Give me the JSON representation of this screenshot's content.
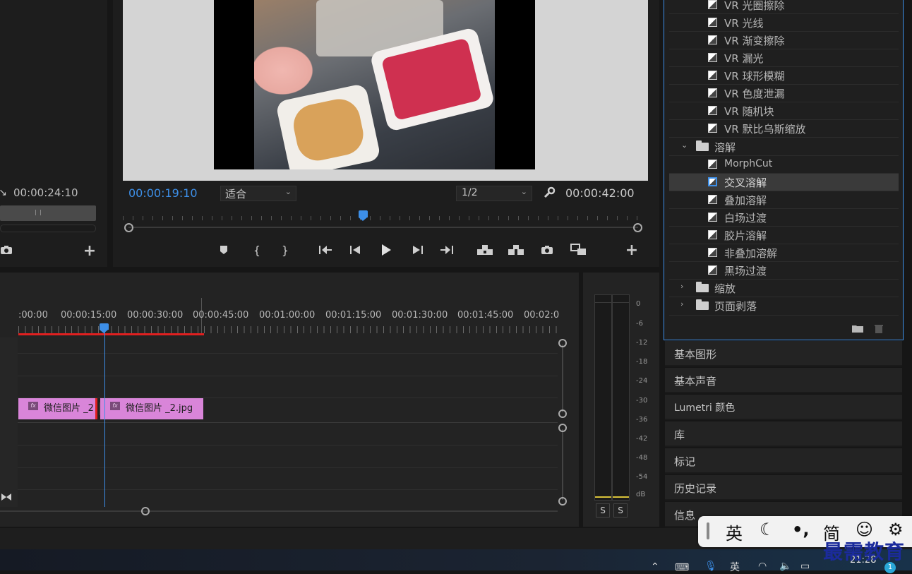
{
  "source_monitor": {
    "timecode": "00:00:24:10"
  },
  "program_monitor": {
    "current_time": "00:00:19:10",
    "fit_label": "适合",
    "resolution_label": "1/2",
    "duration": "00:00:42:00"
  },
  "effects": {
    "items": [
      {
        "label": "VR 光圈擦除",
        "type": "effect"
      },
      {
        "label": "VR 光线",
        "type": "effect"
      },
      {
        "label": "VR 渐变擦除",
        "type": "effect"
      },
      {
        "label": "VR 漏光",
        "type": "effect"
      },
      {
        "label": "VR 球形模糊",
        "type": "effect"
      },
      {
        "label": "VR 色度泄漏",
        "type": "effect"
      },
      {
        "label": "VR 随机块",
        "type": "effect"
      },
      {
        "label": "VR 默比乌斯缩放",
        "type": "effect"
      },
      {
        "label": "溶解",
        "type": "folder",
        "expanded": true
      },
      {
        "label": "MorphCut",
        "type": "effect"
      },
      {
        "label": "交叉溶解",
        "type": "effect",
        "selected": true
      },
      {
        "label": "叠加溶解",
        "type": "effect"
      },
      {
        "label": "白场过渡",
        "type": "effect"
      },
      {
        "label": "胶片溶解",
        "type": "effect"
      },
      {
        "label": "非叠加溶解",
        "type": "effect"
      },
      {
        "label": "黑场过渡",
        "type": "effect"
      },
      {
        "label": "缩放",
        "type": "folder",
        "expanded": false
      },
      {
        "label": "页面剥落",
        "type": "folder",
        "expanded": false
      }
    ]
  },
  "side_panels": [
    "基本图形",
    "基本声音",
    "Lumetri 颜色",
    "库",
    "标记",
    "历史记录",
    "信息"
  ],
  "timeline": {
    "ruler_labels": [
      ":00:00",
      "00:00:15:00",
      "00:00:30:00",
      "00:00:45:00",
      "00:01:00:00",
      "00:01:15:00",
      "00:01:30:00",
      "00:01:45:00",
      "00:02:0"
    ],
    "clips": [
      {
        "name": "微信图片 _2"
      },
      {
        "name": "微信图片 _2.jpg"
      }
    ]
  },
  "audio_meter": {
    "db_labels": [
      "0",
      "-6",
      "-12",
      "-18",
      "-24",
      "-30",
      "-36",
      "-42",
      "-48",
      "-54",
      "dB"
    ],
    "solo_left": "S",
    "solo_right": "S"
  },
  "ime_toolbar": {
    "lang": "英",
    "mode": "简"
  },
  "watermark": "最需教育",
  "taskbar": {
    "clock": "21:28",
    "lang": "英",
    "badge": "1"
  },
  "colors": {
    "accent_blue": "#3d8fe8",
    "clip_pink": "#d985d9",
    "work_area_red": "#e02020",
    "watermark_blue": "#1b2b9c"
  }
}
